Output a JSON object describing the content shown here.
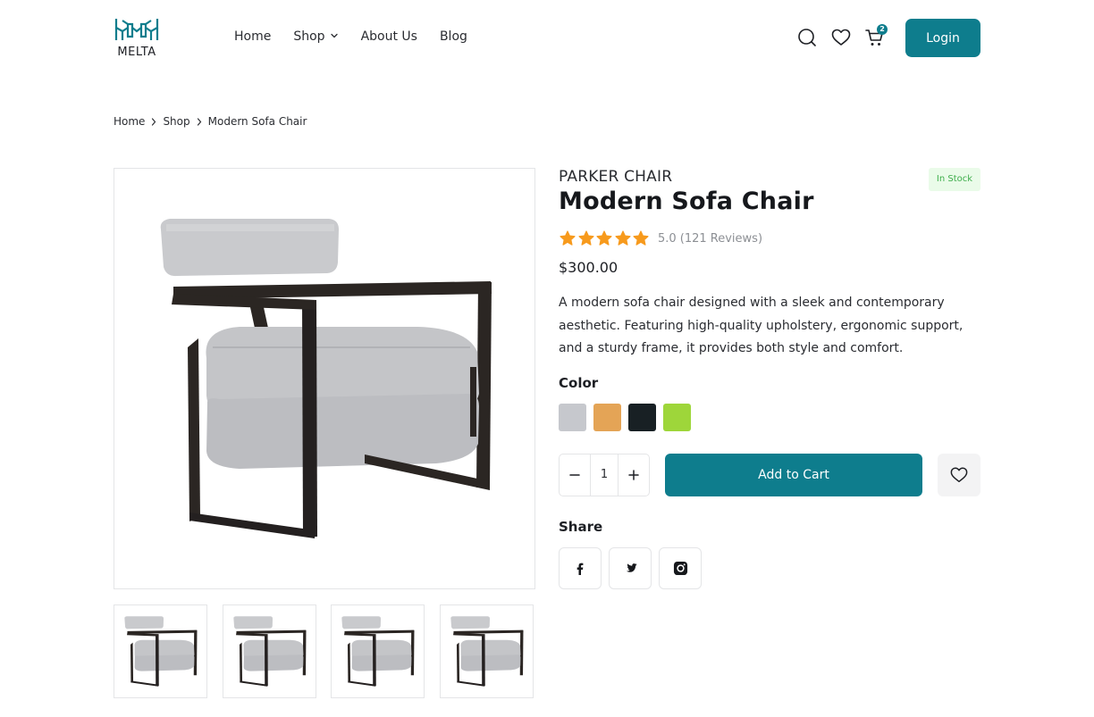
{
  "brand": {
    "name": "MELTA",
    "color": "#0e7d8d"
  },
  "nav": {
    "items": [
      {
        "label": "Home"
      },
      {
        "label": "Shop",
        "has_dropdown": true
      },
      {
        "label": "About Us"
      },
      {
        "label": "Blog"
      }
    ]
  },
  "header_icons": {
    "search": "search-icon",
    "wishlist": "heart-icon",
    "cart": "cart-icon",
    "cart_count": "2"
  },
  "login_label": "Login",
  "breadcrumb": [
    "Home",
    "Shop",
    "Modern Sofa Chair"
  ],
  "product": {
    "brand": "PARKER CHAIR",
    "title": "Modern Sofa Chair",
    "stock_status": "In Stock",
    "rating": 5,
    "rating_text": "5.0 (121 Reviews)",
    "price": "$300.00",
    "description": "A modern sofa chair designed with a sleek and contemporary aesthetic. Featuring high-quality upholstery, ergonomic support, and a sturdy frame, it provides both style and comfort.",
    "color_label": "Color",
    "colors": [
      {
        "name": "gray",
        "hex": "#c6c8cd"
      },
      {
        "name": "orange",
        "hex": "#e4a456"
      },
      {
        "name": "black",
        "hex": "#182024"
      },
      {
        "name": "green",
        "hex": "#9ed63a"
      }
    ],
    "quantity": "1",
    "add_to_cart_label": "Add to Cart",
    "share_label": "Share",
    "share_networks": [
      "facebook-icon",
      "twitter-icon",
      "instagram-icon"
    ],
    "thumbnail_count": 4
  },
  "colors": {
    "primary": "#0e7d8d",
    "star": "#f79a1d",
    "stock_bg": "#eafbe9",
    "stock_text": "#3fae4c"
  }
}
